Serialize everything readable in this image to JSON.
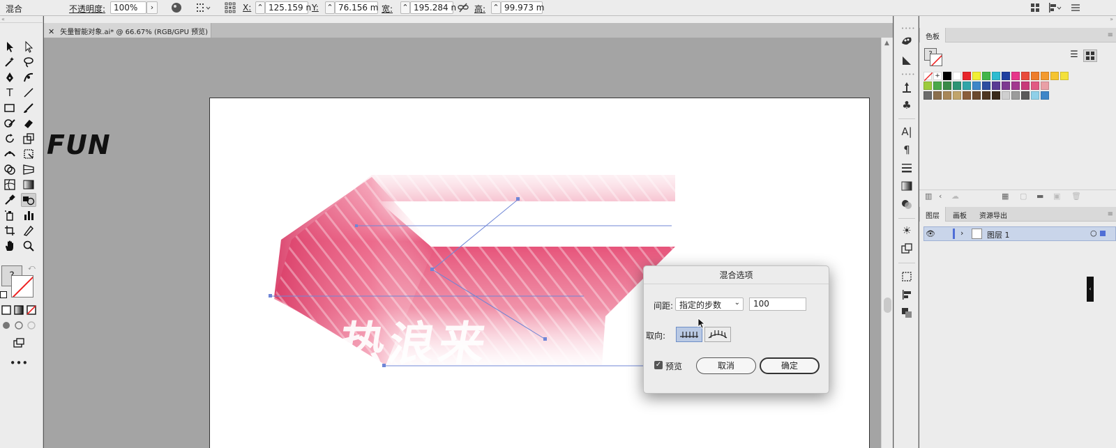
{
  "control_bar": {
    "mode_label": "混合",
    "opacity_label": "不透明度:",
    "opacity_value": "100%",
    "x_label": "X:",
    "x_value": "125.159 n",
    "y_label": "Y:",
    "y_value": "76.156 m",
    "w_label": "宽:",
    "w_value": "195.284 n",
    "h_label": "高:",
    "h_value": "99.973 m"
  },
  "document": {
    "tab_title": "矢量智能对象.ai* @ 66.67% (RGB/GPU 预览)",
    "fun_text": "FUN",
    "artwork_text": "热浪来"
  },
  "blend_dialog": {
    "title": "混合选项",
    "spacing_label": "间距:",
    "spacing_option": "指定的步数",
    "steps_value": "100",
    "orientation_label": "取向:",
    "preview_label": "预览",
    "preview_checked": true,
    "cancel_label": "取消",
    "ok_label": "确定"
  },
  "swatches_panel": {
    "tab_label": "色板",
    "colors_row1": [
      "#000000",
      "#ffffff",
      "#e8262b",
      "#f1ef34",
      "#41b649",
      "#2dbcd0",
      "#1e3fa0",
      "#e7368b",
      "#e94b3c",
      "#ee7d2b",
      "#f39a2f",
      "#f5c431",
      "#f4e13b"
    ],
    "colors_row2": [
      "#9dcb3c",
      "#4aa84a",
      "#3a8a48",
      "#2d9474",
      "#30a5a8",
      "#3e86c8",
      "#2d4da0",
      "#5a3b94",
      "#7d3a91",
      "#a2398f",
      "#c83a7a",
      "#e15a83",
      "#e9a0a6"
    ],
    "colors_row3": [
      "#6c6c6c",
      "#8b6f4e",
      "#a88658",
      "#c1a46b",
      "#8b5e3c",
      "#6c4a2f",
      "#4f3621",
      "#3b2a1a",
      "#cfcfcf",
      "#9c9c9c",
      "#5a5a5a",
      "#8fd0e8",
      "#3e86c8"
    ]
  },
  "layers_panel": {
    "tabs": [
      "图层",
      "画板",
      "资源导出"
    ],
    "layer_name": "图层 1"
  }
}
